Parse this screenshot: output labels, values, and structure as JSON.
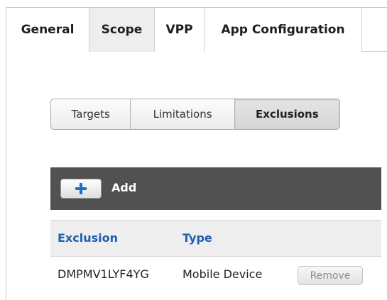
{
  "top_tabs": [
    {
      "label": "General"
    },
    {
      "label": "Scope",
      "active": true
    },
    {
      "label": "VPP"
    },
    {
      "label": "App Configuration"
    }
  ],
  "scope_tabs": [
    {
      "label": "Targets"
    },
    {
      "label": "Limitations"
    },
    {
      "label": "Exclusions",
      "active": true
    }
  ],
  "toolbar": {
    "add_label": "Add",
    "add_icon": "plus-icon",
    "background": "#515151",
    "icon_color": "#1d6fc6"
  },
  "table": {
    "headers": [
      "Exclusion",
      "Type"
    ],
    "header_color": "#1f5fb0",
    "rows": [
      {
        "exclusion": "DMPMV1LYF4YG",
        "type": "Mobile Device",
        "action_label": "Remove"
      }
    ]
  }
}
